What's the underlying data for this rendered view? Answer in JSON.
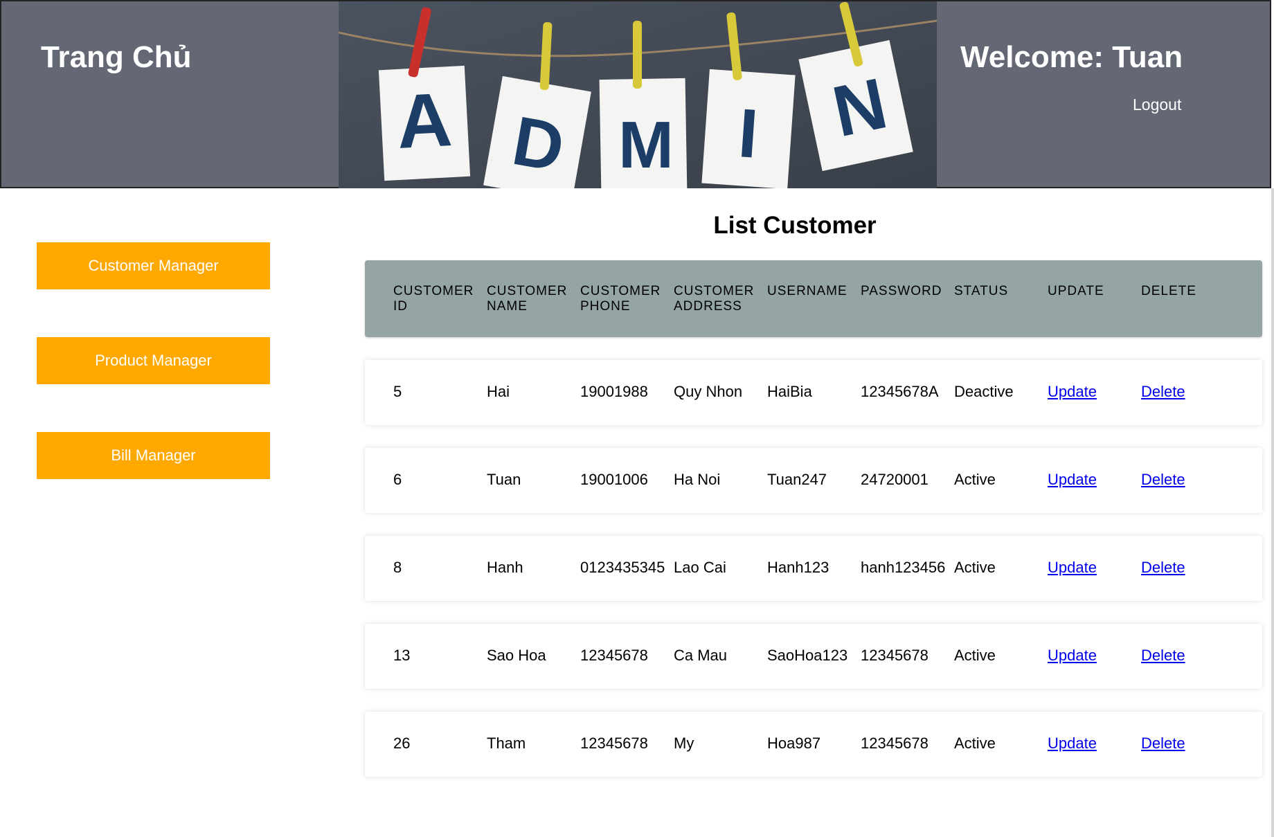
{
  "header": {
    "brand": "Trang Chủ",
    "welcome": "Welcome: Tuan",
    "logout_label": "Logout",
    "banner_letters": [
      "A",
      "D",
      "M",
      "I",
      "N"
    ]
  },
  "sidebar": {
    "items": [
      {
        "label": "Customer Manager"
      },
      {
        "label": "Product Manager"
      },
      {
        "label": "Bill Manager"
      }
    ]
  },
  "main": {
    "title": "List Customer",
    "columns": [
      "CUSTOMER ID",
      "CUSTOMER NAME",
      "CUSTOMER PHONE",
      "CUSTOMER ADDRESS",
      "USERNAME",
      "PASSWORD",
      "STATUS",
      "UPDATE",
      "DELETE"
    ],
    "rows": [
      {
        "id": "5",
        "name": "Hai",
        "phone": "19001988",
        "address": "Quy Nhon",
        "username": "HaiBia",
        "password": "12345678A",
        "status": "Deactive",
        "update": "Update",
        "delete": "Delete"
      },
      {
        "id": "6",
        "name": "Tuan",
        "phone": "19001006",
        "address": "Ha Noi",
        "username": "Tuan247",
        "password": "24720001",
        "status": "Active",
        "update": "Update",
        "delete": "Delete"
      },
      {
        "id": "8",
        "name": "Hanh",
        "phone": "0123435345",
        "address": "Lao Cai",
        "username": "Hanh123",
        "password": "hanh123456",
        "status": "Active",
        "update": "Update",
        "delete": "Delete"
      },
      {
        "id": "13",
        "name": "Sao Hoa",
        "phone": "12345678",
        "address": "Ca Mau",
        "username": "SaoHoa123",
        "password": "12345678",
        "status": "Active",
        "update": "Update",
        "delete": "Delete"
      },
      {
        "id": "26",
        "name": "Tham",
        "phone": "12345678",
        "address": "My",
        "username": "Hoa987",
        "password": "12345678",
        "status": "Active",
        "update": "Update",
        "delete": "Delete"
      }
    ]
  },
  "colors": {
    "header_bg": "#636874",
    "sidebar_button": "#ffa800",
    "table_header": "#95a5a6",
    "link": "#0000ee",
    "banner_letter": "#1c3d66"
  }
}
